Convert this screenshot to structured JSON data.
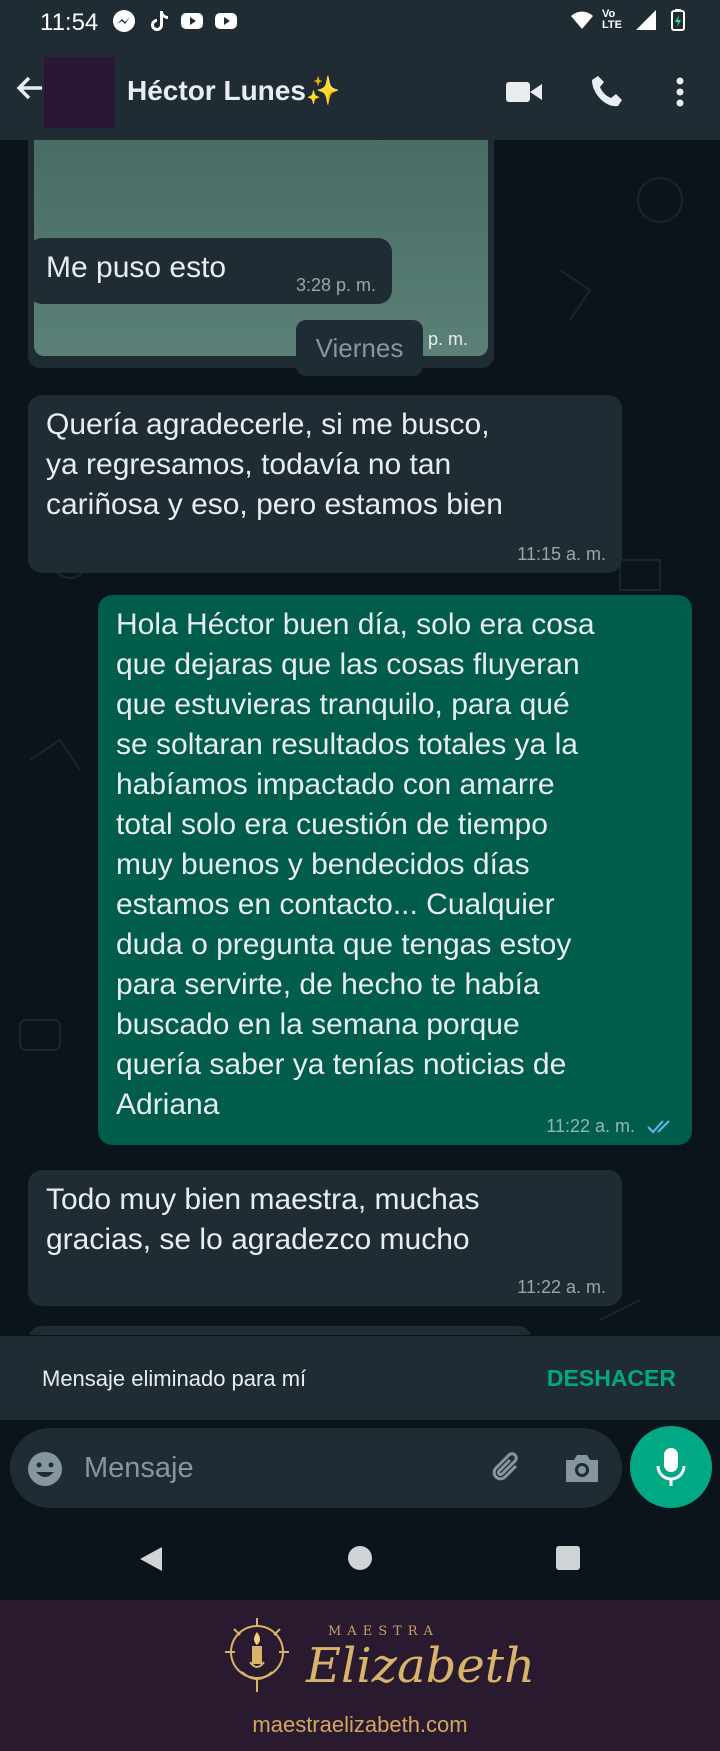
{
  "status_bar": {
    "time": "11:54",
    "left_icons": [
      "messenger-icon",
      "tiktok-icon",
      "youtube-icon",
      "youtube-icon"
    ],
    "right_icons": [
      "wifi-icon",
      "volte-icon",
      "signal-icon",
      "battery-icon"
    ],
    "volte_text": "Vo LTE"
  },
  "header": {
    "contact_name": "Héctor Lunes✨",
    "icons": [
      "back-arrow-icon",
      "video-call-icon",
      "phone-call-icon",
      "more-vert-icon"
    ]
  },
  "chat": {
    "image_message": {
      "time": "3:28 p. m."
    },
    "messages": [
      {
        "direction": "in",
        "lines": [
          "Me puso esto"
        ],
        "time": "3:28 p. m."
      },
      {
        "direction": "in",
        "lines": [
          "Quería agradecerle, si me busco,",
          "ya regresamos, todavía no tan",
          "cariñosa y eso, pero estamos bien"
        ],
        "time": "11:15 a. m."
      },
      {
        "direction": "out",
        "lines": [
          "Hola Héctor buen día, solo era cosa",
          "que dejaras que las cosas fluyeran",
          "que estuvieras tranquilo, para qué",
          "se soltaran resultados totales ya la",
          "habíamos impactado con amarre",
          "total solo era cuestión de tiempo",
          "muy buenos y bendecidos días",
          "estamos en contacto... Cualquier",
          "duda o pregunta que tengas estoy",
          "para servirte, de hecho te había",
          "buscado en la semana porque",
          "quería saber ya tenías noticias de",
          "Adriana"
        ],
        "time": "11:22 a. m.",
        "read_receipt": "double-check-icon"
      },
      {
        "direction": "in",
        "lines": [
          "Todo muy bien maestra, muchas",
          "gracias, se lo agradezco mucho"
        ],
        "time": "11:22 a. m."
      }
    ],
    "day_chip": "Viernes",
    "colors": {
      "incoming": "#1f2c34",
      "outgoing": "#005c4b",
      "background": "#0b141a"
    }
  },
  "snackbar": {
    "text": "Mensaje eliminado para mí",
    "action": "DESHACER",
    "action_color": "#00a884"
  },
  "input_bar": {
    "placeholder": "Mensaje",
    "icons": [
      "emoji-icon",
      "attach-icon",
      "camera-icon",
      "mic-icon"
    ]
  },
  "nav_bar": {
    "icons": [
      "nav-back-icon",
      "nav-home-icon",
      "nav-recents-icon"
    ]
  },
  "brand": {
    "small_text": "MAESTRA",
    "name": "Elizabeth",
    "url": "maestraelizabeth.com"
  }
}
